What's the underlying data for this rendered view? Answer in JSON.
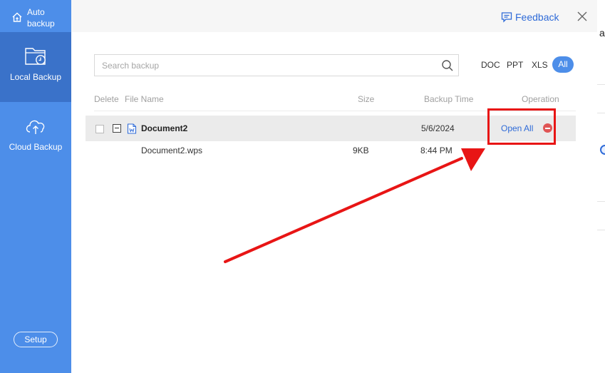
{
  "sidebar": {
    "auto_backup": "Auto backup",
    "items": [
      {
        "label": "Local Backup",
        "icon": "folder-clock-icon"
      },
      {
        "label": "Cloud Backup",
        "icon": "cloud-upload-icon"
      }
    ],
    "setup": "Setup"
  },
  "header": {
    "feedback": "Feedback"
  },
  "search": {
    "placeholder": "Search backup"
  },
  "filters": [
    "DOC",
    "PPT",
    "XLS",
    "All"
  ],
  "active_filter": "All",
  "columns": {
    "delete": "Delete",
    "file_name": "File Name",
    "size": "Size",
    "backup_time": "Backup Time",
    "operation": "Operation"
  },
  "group": {
    "name": "Document2",
    "date": "5/6/2024",
    "operation": "Open All",
    "file": {
      "name": "Document2.wps",
      "size": "9KB",
      "time": "8:44 PM"
    }
  },
  "colors": {
    "sidebar": "#4d8ee9",
    "sidebar_active": "#3a72c9",
    "accent": "#2f6bd8",
    "annotation": "#e81515",
    "delete": "#e05555"
  }
}
